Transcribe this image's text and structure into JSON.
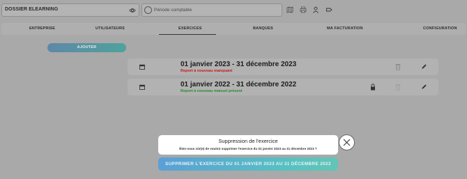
{
  "topbar": {
    "dossier_label": "DOSSIER ELEARNING",
    "periode_placeholder": "Période comptable",
    "icons": [
      "eye-icon",
      "map-icon",
      "printer-icon",
      "user-icon",
      "tag-icon"
    ]
  },
  "nav": {
    "tabs": [
      "ENTREPRISE",
      "UTILISATEURS",
      "EXERCICES",
      "BANQUES",
      "MA FACTURATION",
      "CONFIGURATION"
    ],
    "active": "EXERCICES"
  },
  "actions": {
    "add_label": "AJOUTER"
  },
  "exercises": [
    {
      "title": "01 janvier 2023 - 31 décembre 2023",
      "status": "Report à nouveau manquant",
      "status_color": "#cc1b1b",
      "locked": false
    },
    {
      "title": "01 janvier 2022 - 31 décembre 2022",
      "status": "Report à nouveau manuel présent",
      "status_color": "#2e8b2e",
      "locked": true
    }
  ],
  "modal": {
    "title": "Suppression de l'exercice",
    "message": "Êtes-vous sûr(e) de vouloir supprimer l'exercice du 01 janvier 2023 au 31 décembre 2023 ?",
    "confirm_label": "SUPPRIMER L'EXERCICE DU 01 JANVIER 2023 AU 31 DÉCEMBRE 2023"
  }
}
